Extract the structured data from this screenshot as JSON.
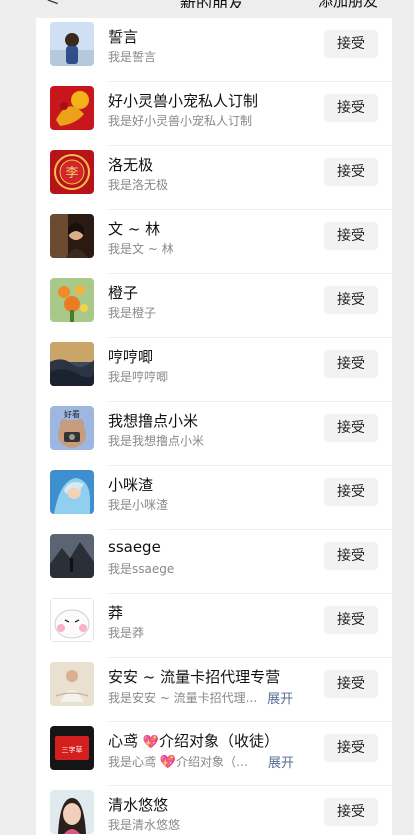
{
  "header": {
    "back_icon": "chevron-left-icon",
    "title": "新的朋友",
    "action": "添加朋友"
  },
  "requests": [
    {
      "name": "誓言",
      "message": "我是誓言",
      "accept_label": "接受"
    },
    {
      "name": "好小灵兽小宠私人订制",
      "message": "我是好小灵兽小宠私人订制",
      "accept_label": "接受"
    },
    {
      "name": "洛无极",
      "message": "我是洛无极",
      "accept_label": "接受"
    },
    {
      "name": "文 ~ 林",
      "message": "我是文 ~ 林",
      "accept_label": "接受"
    },
    {
      "name": "橙子",
      "message": "我是橙子",
      "accept_label": "接受"
    },
    {
      "name": "哼哼唧",
      "message": "我是哼哼唧",
      "accept_label": "接受"
    },
    {
      "name": "我想撸点小米",
      "message": "我是我想撸点小米",
      "accept_label": "接受"
    },
    {
      "name": "小咪渣",
      "message": "我是小咪渣",
      "accept_label": "接受"
    },
    {
      "name": "ssaege",
      "message": "我是ssaege",
      "accept_label": "接受"
    },
    {
      "name": "莽",
      "message": "我是莽",
      "accept_label": "接受"
    },
    {
      "name": "安安 ~ 流量卡招代理专营",
      "message": "我是安安 ~ 流量卡招代理...",
      "expand_label": "展开",
      "accept_label": "接受"
    },
    {
      "name_prefix": "心鸢 ",
      "name_emoji": "💖",
      "name_suffix": "介绍对象（收徒）",
      "message_prefix": "我是心鸢 ",
      "message_emoji": "💖",
      "message_suffix": "介绍对象（收...",
      "expand_label": "展开",
      "accept_label": "接受"
    },
    {
      "name": "清水悠悠",
      "message": "我是清水悠悠",
      "accept_label": "接受"
    }
  ],
  "avatar_badge_text": "好看",
  "avatar_seal_text": "李",
  "avatar_logo_text": "三字草"
}
